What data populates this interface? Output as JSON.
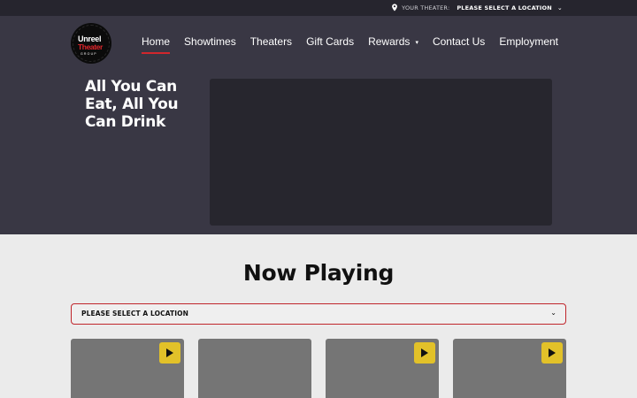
{
  "topbar": {
    "theater_label": "YOUR THEATER:",
    "location_value": "PLEASE SELECT A LOCATION",
    "caret": "⌄"
  },
  "logo": {
    "line1": "Unreel",
    "line2": "Theater",
    "line3": "GROUP"
  },
  "nav": {
    "items": [
      {
        "label": "Home"
      },
      {
        "label": "Showtimes"
      },
      {
        "label": "Theaters"
      },
      {
        "label": "Gift Cards"
      },
      {
        "label": "Rewards"
      },
      {
        "label": "Contact Us"
      },
      {
        "label": "Employment"
      }
    ],
    "rewards_caret": "▾"
  },
  "hero": {
    "title": "All You Can Eat, All You Can Drink"
  },
  "now_playing": {
    "title": "Now Playing",
    "select_value": "PLEASE SELECT A LOCATION",
    "select_caret": "⌄",
    "cards_with_trailer": [
      true,
      false,
      true,
      true
    ]
  },
  "colors": {
    "accent_red": "#d1262c",
    "play_yellow": "#e2c129",
    "hero_bg": "#393744",
    "topbar_bg": "#26252e"
  }
}
